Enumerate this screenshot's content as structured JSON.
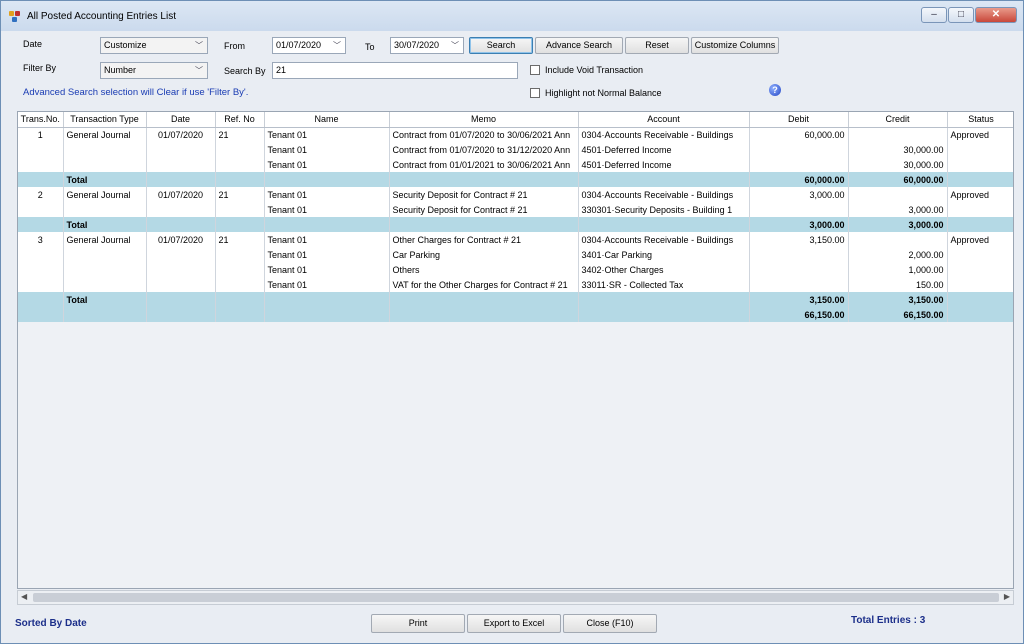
{
  "window": {
    "title": "All Posted Accounting Entries List"
  },
  "filters": {
    "date_label": "Date",
    "date_value": "Customize",
    "from_label": "From",
    "from_value": "01/07/2020",
    "to_label": "To",
    "to_value": "30/07/2020",
    "filter_by_label": "Filter By",
    "filter_by_value": "Number",
    "search_by_label": "Search By",
    "search_by_value": "21",
    "include_void_label": "Include Void Transaction",
    "highlight_label": "Highlight not Normal Balance",
    "advanced_note": "Advanced Search selection will Clear if use 'Filter By'."
  },
  "buttons": {
    "search": "Search",
    "advance_search": "Advance Search",
    "reset": "Reset",
    "customize_columns": "Customize Columns",
    "print": "Print",
    "export": "Export to Excel",
    "close": "Close (F10)"
  },
  "table": {
    "columns": [
      "Trans.No.",
      "Transaction Type",
      "Date",
      "Ref. No",
      "Name",
      "Memo",
      "Account",
      "Debit",
      "Credit",
      "Status"
    ],
    "rows": [
      {
        "t": "1",
        "type": "General Journal",
        "date": "01/07/2020",
        "ref": "21",
        "name": "Tenant 01",
        "memo": "Contract from 01/07/2020 to 30/06/2021 Ann",
        "account": "0304·Accounts Receivable - Buildings",
        "debit": "60,000.00",
        "credit": "",
        "status": "Approved"
      },
      {
        "t": "",
        "type": "",
        "date": "",
        "ref": "",
        "name": "Tenant 01",
        "memo": "Contract from 01/07/2020 to 31/12/2020 Ann",
        "account": "4501·Deferred Income",
        "debit": "",
        "credit": "30,000.00",
        "status": ""
      },
      {
        "t": "",
        "type": "",
        "date": "",
        "ref": "",
        "name": "Tenant 01",
        "memo": "Contract from 01/01/2021 to 30/06/2021 Ann",
        "account": "4501·Deferred Income",
        "debit": "",
        "credit": "30,000.00",
        "status": ""
      },
      {
        "total": true,
        "type": "Total",
        "debit": "60,000.00",
        "credit": "60,000.00"
      },
      {
        "t": "2",
        "type": "General Journal",
        "date": "01/07/2020",
        "ref": "21",
        "name": "Tenant 01",
        "memo": "Security Deposit for Contract # 21",
        "account": "0304·Accounts Receivable - Buildings",
        "debit": "3,000.00",
        "credit": "",
        "status": "Approved"
      },
      {
        "t": "",
        "type": "",
        "date": "",
        "ref": "",
        "name": "Tenant 01",
        "memo": "Security Deposit for Contract # 21",
        "account": "330301·Security Deposits - Building 1",
        "debit": "",
        "credit": "3,000.00",
        "status": ""
      },
      {
        "total": true,
        "type": "Total",
        "debit": "3,000.00",
        "credit": "3,000.00"
      },
      {
        "t": "3",
        "type": "General Journal",
        "date": "01/07/2020",
        "ref": "21",
        "name": "Tenant 01",
        "memo": "Other Charges for Contract # 21",
        "account": "0304·Accounts Receivable - Buildings",
        "debit": "3,150.00",
        "credit": "",
        "status": "Approved"
      },
      {
        "t": "",
        "type": "",
        "date": "",
        "ref": "",
        "name": "Tenant 01",
        "memo": "Car Parking",
        "account": "3401·Car Parking",
        "debit": "",
        "credit": "2,000.00",
        "status": ""
      },
      {
        "t": "",
        "type": "",
        "date": "",
        "ref": "",
        "name": "Tenant 01",
        "memo": "Others",
        "account": "3402·Other Charges",
        "debit": "",
        "credit": "1,000.00",
        "status": ""
      },
      {
        "t": "",
        "type": "",
        "date": "",
        "ref": "",
        "name": "Tenant 01",
        "memo": "VAT for the Other Charges for Contract # 21",
        "account": "33011·SR - Collected Tax",
        "debit": "",
        "credit": "150.00",
        "status": ""
      },
      {
        "total": true,
        "type": "Total",
        "debit": "3,150.00",
        "credit": "3,150.00"
      },
      {
        "total": true,
        "grand": true,
        "type": "",
        "debit": "66,150.00",
        "credit": "66,150.00"
      }
    ]
  },
  "status": {
    "sorted": "Sorted By Date",
    "total_entries": "Total Entries : 3"
  }
}
